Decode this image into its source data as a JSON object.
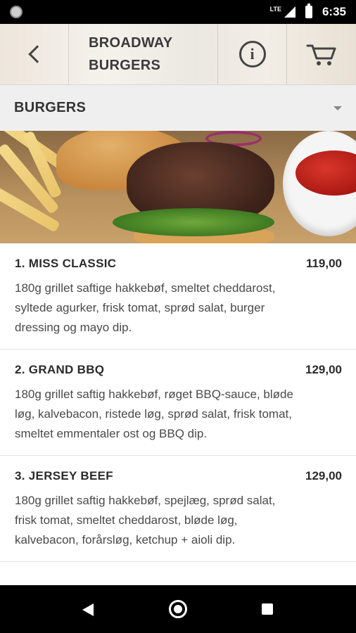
{
  "status_bar": {
    "network": "LTE",
    "time": "6:35"
  },
  "header": {
    "title_line1": "BROADWAY",
    "title_line2": "BURGERS",
    "back_icon": "chevron-left-icon",
    "info_icon": "info-icon",
    "cart_icon": "cart-icon"
  },
  "category": {
    "label": "BURGERS"
  },
  "menu": {
    "items": [
      {
        "name": "1. MISS CLASSIC",
        "price": "119,00",
        "description": "180g grillet saftige hakkebøf, smeltet cheddarost, syltede agurker, frisk tomat, sprød salat, burger dressing og mayo dip."
      },
      {
        "name": "2. GRAND BBQ",
        "price": "129,00",
        "description": "180g grillet saftig hakkebøf, røget BBQ-sauce, bløde løg, kalvebacon, ristede løg, sprød salat, frisk tomat, smeltet emmentaler ost og BBQ dip."
      },
      {
        "name": "3. JERSEY BEEF",
        "price": "129,00",
        "description": "180g grillet saftig hakkebøf, spejlæg, sprød salat, frisk tomat, smeltet cheddarost, bløde løg, kalvebacon, forårsløg, ketchup + aioli dip."
      }
    ]
  },
  "colors": {
    "status_bar": "#000000",
    "category_bg": "#efefef",
    "nav_bar": "#000000"
  }
}
